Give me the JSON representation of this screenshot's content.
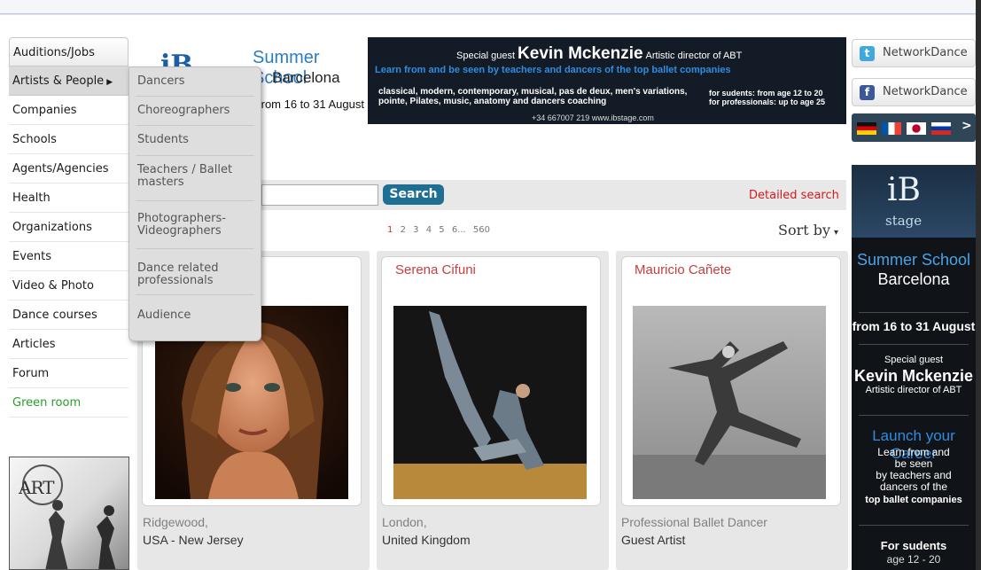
{
  "nav": {
    "items": [
      "Auditions/Jobs",
      "Artists & People",
      "Companies",
      "Schools",
      "Agents/Agencies",
      "Health",
      "Organizations",
      "Events",
      "Video & Photo",
      "Dance courses",
      "Articles",
      "Forum",
      "Green room"
    ],
    "submenu_arrow": "▶"
  },
  "submenu": {
    "items": [
      "Dancers",
      "Choreographers",
      "Students",
      "Teachers / Ballet masters",
      "Photographers-Videographers",
      "Dance related professionals",
      "Audience"
    ]
  },
  "banner": {
    "logo": "iB",
    "summer_school": "Summer School",
    "city": "Barcelona",
    "dates": "from 16 to 31 August",
    "special_guest_label": "Special guest",
    "guest_name": "Kevin Mckenzie",
    "guest_role": "Artistic director of ABT",
    "learn": "Learn from and be seen by teachers and dancers of the top ballet companies",
    "classical": "classical, modern, contemporary, musical, pas de deux, men's variations, pointe, Pilates, music, anatomy and dancers coaching",
    "students": "for sudents: from age 12 to 20",
    "professionals": "for professionals: up to age 25",
    "phone": "+34 667007 219  www.ibstage.com"
  },
  "search": {
    "placeholder": "",
    "button_label": "Search",
    "detailed_link": "Detailed search"
  },
  "pagination": {
    "pages": [
      "1",
      "2",
      "3",
      "4",
      "5",
      "6...",
      "560"
    ],
    "current": "1"
  },
  "sort": {
    "label": "Sort by",
    "caret": "▾"
  },
  "profiles": [
    {
      "name": "",
      "line1": "Ridgewood,",
      "line2": "USA - New Jersey"
    },
    {
      "name": "Serena Cifuni",
      "line1": "London,",
      "line2": "United Kingdom"
    },
    {
      "name": "Mauricio Cañete",
      "line1": "Professional Ballet Dancer",
      "line2": "Guest Artist"
    }
  ],
  "social": {
    "twitter_label": "NetworkDance",
    "facebook_label": "NetworkDance",
    "twitter_icon": "t",
    "facebook_icon": "f",
    "flags_next": ">"
  },
  "ad": {
    "logo": "iB",
    "logo_sub": "stage",
    "summer_school": "Summer School",
    "city": "Barcelona",
    "dates": "from 16 to 31 August",
    "special_guest": "Special guest",
    "guest_name": "Kevin Mckenzie",
    "guest_role": "Artistic director of ABT",
    "launch": "Launch your Career",
    "learn_lines": [
      "Learn from and",
      "be seen",
      "by teachers and",
      "dancers of the"
    ],
    "companies": "top ballet companies",
    "for_students": "For sudents",
    "age": "age 12 - 20"
  },
  "art_logo": "ART",
  "colors": {
    "accent_red": "#c83d3d",
    "search_blue": "#1e6f93",
    "green_room": "#2a9d2a",
    "banner_dark": "#131c26",
    "ad_blue": "#2f8ce0"
  }
}
